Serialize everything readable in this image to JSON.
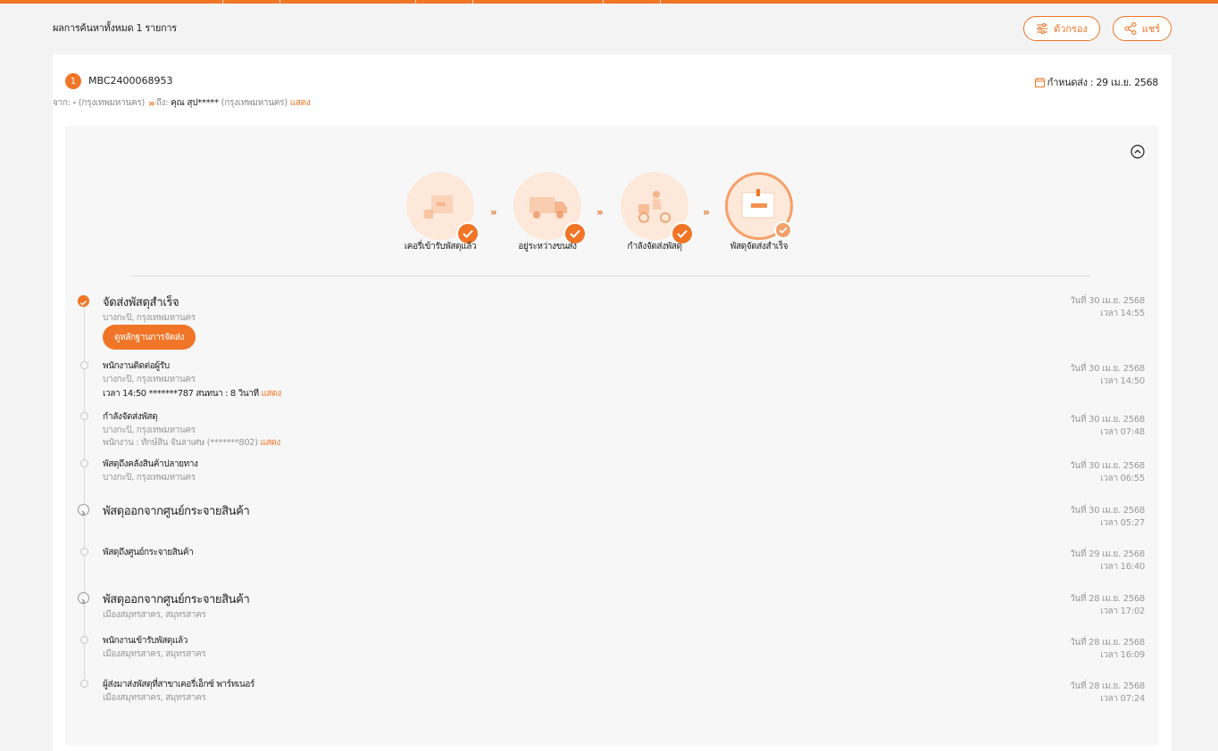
{
  "header": {
    "result_count": "ผลการค้นหาทั้งหมด 1 รายการ",
    "filter_label": "ตัวกรอง",
    "share_label": "แชร์"
  },
  "parcel": {
    "index": "1",
    "tracking_no": "MBC2400068953",
    "due": "กำหนดส่ง : 29 เม.ย. 2568",
    "from_label": "จาก:",
    "from_name": "-",
    "from_place": "(กรุงเทพมหานคร)",
    "arrows": "»",
    "to_label": "ถึง:",
    "to_name": "คุณ สุป*****",
    "to_place": "(กรุงเทพมหานคร)",
    "show_link": "แสดง"
  },
  "steps": [
    {
      "label": "เคอรี่เข้ารับพัสดุแล้ว",
      "icon": "courier-pickup-icon"
    },
    {
      "label": "อยู่ระหว่างขนส่ง",
      "icon": "delivery-truck-icon"
    },
    {
      "label": "กำลังจัดส่งพัสดุ",
      "icon": "motorbike-courier-icon"
    },
    {
      "label": "พัสดุจัดส่งสำเร็จ",
      "icon": "delivered-box-icon"
    }
  ],
  "step_separator": "»",
  "colors": {
    "accent": "#f07527",
    "accent_light": "#fde8da"
  },
  "events": [
    {
      "title": "จัดส่งพัสดุสำเร็จ",
      "sub": "บางกะปิ, กรุงเทพมหานคร",
      "button": "ดูหลักฐานการจัดส่ง",
      "date": "วันที่ 30 เม.ย. 2568",
      "time": "เวลา 14:55"
    },
    {
      "title": "พนักงานติดต่อผู้รับ",
      "sub": "บางกะปิ, กรุงเทพมหานคร",
      "extra": "เวลา 14:50 *******787 สนทนา : 8 วินาที",
      "extra_link": "แสดง",
      "date": "วันที่ 30 เม.ย. 2568",
      "time": "เวลา 14:50"
    },
    {
      "title": "กำลังจัดส่งพัสดุ",
      "sub": "บางกะปิ, กรุงเทพมหานคร",
      "extra": "พนักงาน : ทักษ์สิน จันลาเศษ (*******802)",
      "extra_link": "แสดง",
      "date": "วันที่ 30 เม.ย. 2568",
      "time": "เวลา 07:48"
    },
    {
      "title": "พัสดุถึงคลังสินค้าปลายทาง",
      "sub": "บางกะปิ, กรุงเทพมหานคร",
      "date": "วันที่ 30 เม.ย. 2568",
      "time": "เวลา 06:55"
    },
    {
      "title": "พัสดุออกจากศูนย์กระจายสินค้า",
      "date": "วันที่ 30 เม.ย. 2568",
      "time": "เวลา 05:27"
    },
    {
      "title": "พัสดุถึงศูนย์กระจายสินค้า",
      "date": "วันที่ 29 เม.ย. 2568",
      "time": "เวลา 16:40"
    },
    {
      "title": "พัสดุออกจากศูนย์กระจายสินค้า",
      "sub": "เมืองสมุทรสาคร, สมุทรสาคร",
      "date": "วันที่ 28 เม.ย. 2568",
      "time": "เวลา 17:02"
    },
    {
      "title": "พนักงานเข้ารับพัสดุแล้ว",
      "sub": "เมืองสมุทรสาคร, สมุทรสาคร",
      "date": "วันที่ 28 เม.ย. 2568",
      "time": "เวลา 16:09"
    },
    {
      "title": "ผู้ส่งมาส่งพัสดุที่สาขาเคอรี่เอ็กซ์ พาร์ทเนอร์",
      "sub": "เมืองสมุทรสาคร, สมุทรสาคร",
      "date": "วันที่ 28 เม.ย. 2568",
      "time": "เวลา 07:24"
    }
  ]
}
